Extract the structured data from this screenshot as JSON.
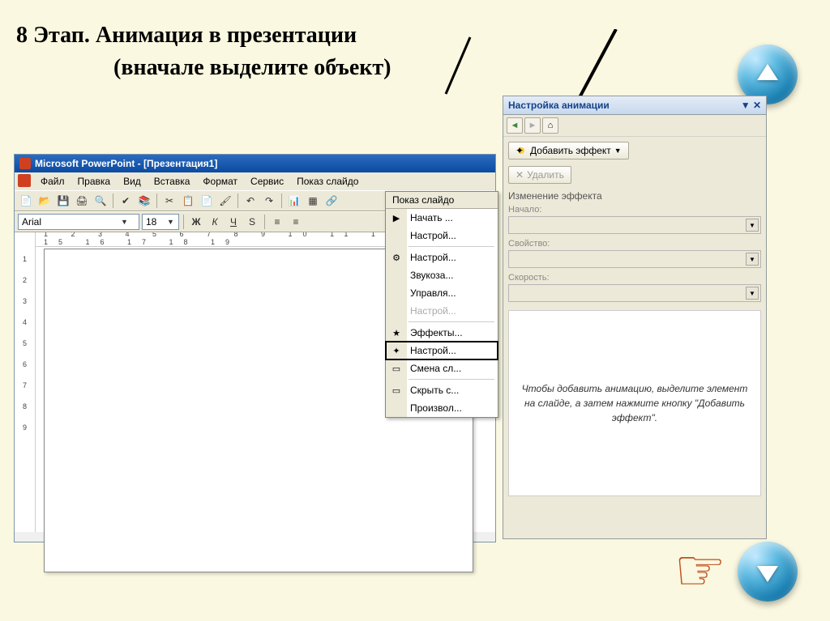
{
  "slide": {
    "title": "8 Этап. Анимация в презентации",
    "subtitle": "(вначале выделите объект)"
  },
  "pp": {
    "title": "Microsoft PowerPoint - [Презентация1]",
    "menus": [
      "Файл",
      "Правка",
      "Вид",
      "Вставка",
      "Формат",
      "Сервис",
      "Показ слайдо"
    ],
    "font_name": "Arial",
    "font_size": "18",
    "ruler_top": "1  2  3  4  5  6  7  8  9  10 11 12 13 14 15 16 17 18 19",
    "ruler_left": [
      "1",
      "2",
      "3",
      "4",
      "5",
      "6",
      "7",
      "8",
      "9"
    ],
    "format_buttons": {
      "bold": "Ж",
      "italic": "К",
      "underline": "Ч",
      "shadow": "S"
    }
  },
  "menu": {
    "header": "Показ слайдо",
    "items": [
      {
        "label": "Начать ...",
        "icon": "▶"
      },
      {
        "label": "Настрой...",
        "icon": ""
      },
      {
        "label": "Настрой...",
        "icon": "⚙"
      },
      {
        "label": "Звукоза...",
        "icon": ""
      },
      {
        "label": "Управля...",
        "icon": ""
      },
      {
        "label": "Настрой...",
        "icon": "",
        "disabled": true
      },
      {
        "label": "Эффекты...",
        "icon": "★"
      },
      {
        "label": "Настрой...",
        "icon": "✦",
        "highlight": true
      },
      {
        "label": "Смена сл...",
        "icon": "▭"
      },
      {
        "label": "Скрыть с...",
        "icon": "▭"
      },
      {
        "label": "Произвол...",
        "icon": ""
      }
    ]
  },
  "anim": {
    "title": "Настройка анимации",
    "add_effect": "Добавить эффект",
    "delete": "Удалить",
    "section": "Изменение эффекта",
    "fields": {
      "start": "Начало:",
      "property": "Свойство:",
      "speed": "Скорость:"
    },
    "hint": "Чтобы добавить анимацию, выделите элемент на слайде, а затем нажмите кнопку \"Добавить эффект\"."
  },
  "nav": {
    "hand": "☞"
  }
}
